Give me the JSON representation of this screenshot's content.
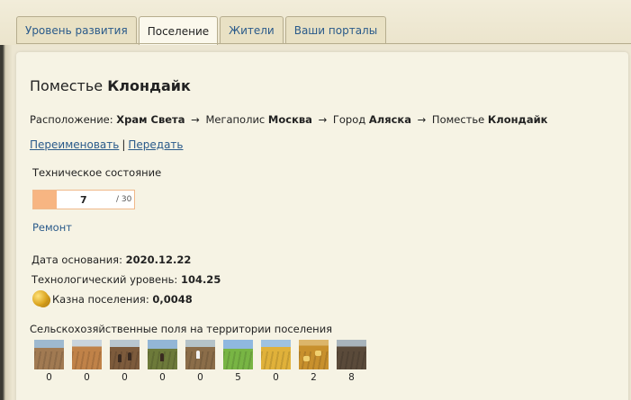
{
  "tabs": [
    {
      "label": "Уровень развития",
      "active": false
    },
    {
      "label": "Поселение",
      "active": true
    },
    {
      "label": "Жители",
      "active": false
    },
    {
      "label": "Ваши порталы",
      "active": false
    }
  ],
  "title": {
    "prefix": "Поместье",
    "name": "Клондайк"
  },
  "location": {
    "label": "Расположение:",
    "parts": [
      {
        "type": "",
        "name": "Храм Света"
      },
      {
        "type": "Мегаполис",
        "name": "Москва"
      },
      {
        "type": "Город",
        "name": "Аляска"
      },
      {
        "type": "Поместье",
        "name": "Клондайк"
      }
    ],
    "arrow": "→"
  },
  "actions": {
    "rename": "Переименовать",
    "separator": "|",
    "transfer": "Передать"
  },
  "tech_state": {
    "label": "Техническое состояние",
    "value": 7,
    "max": 30,
    "max_text": "/ 30",
    "fraction": 0.233
  },
  "repair": "Ремонт",
  "info": {
    "founded_label": "Дата основания:",
    "founded": "2020.12.22",
    "tech_level_label": "Технологический уровень:",
    "tech_level": "104.25",
    "treasury_label": "Казна поселения:",
    "treasury": "0,0048"
  },
  "icons": {
    "coin": "gold-coin-icon"
  },
  "fields": {
    "label": "Сельскохозяйственные поля на территории поселения",
    "counts": [
      "0",
      "0",
      "0",
      "0",
      "0",
      "5",
      "0",
      "2",
      "8"
    ]
  },
  "colors": {
    "link": "#2a5a8a",
    "progress_fill": "#f7b582",
    "progress_border": "#f0b98a"
  }
}
